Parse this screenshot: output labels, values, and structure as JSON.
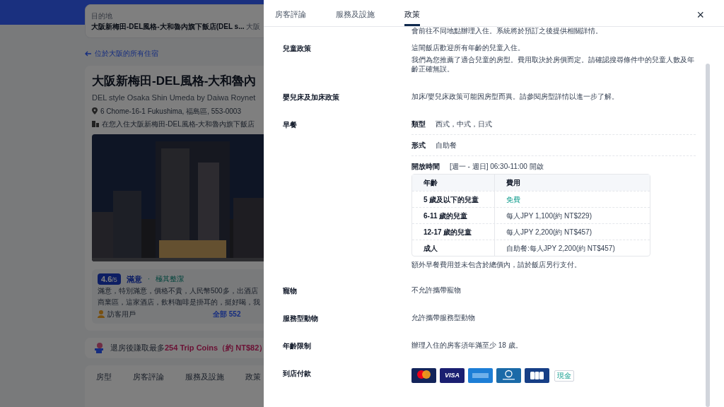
{
  "background_page": {
    "search": {
      "label": "目的地",
      "value": "大阪新梅田-DEL風格-大和魯內旗下飯店(DEL s...",
      "city": "大阪"
    },
    "back_link": "位於大阪的所有住宿",
    "hotel": {
      "name": "大阪新梅田-DEL風格-大和魯內",
      "name_en": "DEL style Osaka Shin Umeda by Daiwa Roynet",
      "address": "6 Chome-16-1 Fukushima, 福島區, 553-0003",
      "notice": "在您入住大阪新梅田-DEL風格-大和魯內旗下飯店"
    },
    "review": {
      "score": "4.6",
      "scale": "/5",
      "rating": "滿意",
      "separator": "·",
      "tag": "極其整潔",
      "lines": [
        "滿意，特別滿意，價格不貴，人民幣500多，出酒店",
        "商業區，這家酒店，飲料咖啡是掛耳的，挺好喝，我"
      ],
      "user": "訪客用戶",
      "all_link": "全部 552"
    },
    "coins": {
      "prefix": "退房後賺取最多",
      "amount": "254 Trip Coins（約 NT$82）"
    },
    "tabs": [
      {
        "label": "房型"
      },
      {
        "label": "房客評論"
      },
      {
        "label": "服務及設施"
      },
      {
        "label": "政策"
      }
    ]
  },
  "panel": {
    "tabs": [
      {
        "label": "房客評論",
        "selected": false
      },
      {
        "label": "服務及設施",
        "selected": false
      },
      {
        "label": "政策",
        "selected": true
      }
    ],
    "close": "×",
    "top_text": "會前往不同地點辦理入住。系統將於預訂之後提供相關詳情。",
    "policies": [
      {
        "kind": "text",
        "label": "兒童政策",
        "texts": [
          "這間飯店歡迎所有年齡的兒童入住。",
          "我們為您推薦了適合兒童的房型。費用取決於房價而定。請確認搜尋條件中的兒童人數及年齡正確無誤。"
        ]
      },
      {
        "kind": "text",
        "label": "嬰兒床及加床政策",
        "texts": [
          "加床/嬰兒床政策可能因房型而異。請參閱房型詳情以進一步了解。"
        ]
      },
      {
        "kind": "breakfast",
        "label": "早餐",
        "details": [
          {
            "name": "類型",
            "value": "西式，中式，日式"
          },
          {
            "name": "形式",
            "value": "自助餐"
          },
          {
            "name": "開放時間",
            "value": "[週一 - 週日] 06:30-11:00 開啟"
          }
        ],
        "table": {
          "columns": [
            "年齡",
            "費用"
          ],
          "rows": [
            {
              "age": "5 歲及以下的兒童",
              "fee": "免費",
              "free": true
            },
            {
              "age": "6-11 歲的兒童",
              "fee": "每人JPY 1,100(約 NT$229)",
              "free": false
            },
            {
              "age": "12-17 歲的兒童",
              "fee": "每人JPY 2,200(約 NT$457)",
              "free": false
            },
            {
              "age": "成人",
              "fee": "自助餐:每人JPY 2,200(約 NT$457)",
              "free": false
            }
          ]
        },
        "note": "額外早餐費用並未包含於總價內，請於飯店另行支付。"
      },
      {
        "kind": "text",
        "label": "寵物",
        "texts": [
          "不允許攜帶寵物"
        ]
      },
      {
        "kind": "text",
        "label": "服務型動物",
        "texts": [
          "允許攜帶服務型動物"
        ]
      },
      {
        "kind": "text",
        "label": "年齡限制",
        "texts": [
          "辦理入住的房客須年滿至少 18 歲。"
        ]
      },
      {
        "kind": "payment",
        "label": "到店付款",
        "methods": [
          {
            "kind": "mastercard"
          },
          {
            "kind": "visa",
            "label": "VISA"
          },
          {
            "kind": "amex"
          },
          {
            "kind": "diners"
          },
          {
            "kind": "jcb"
          },
          {
            "kind": "cash",
            "label": "現金"
          }
        ]
      }
    ]
  }
}
